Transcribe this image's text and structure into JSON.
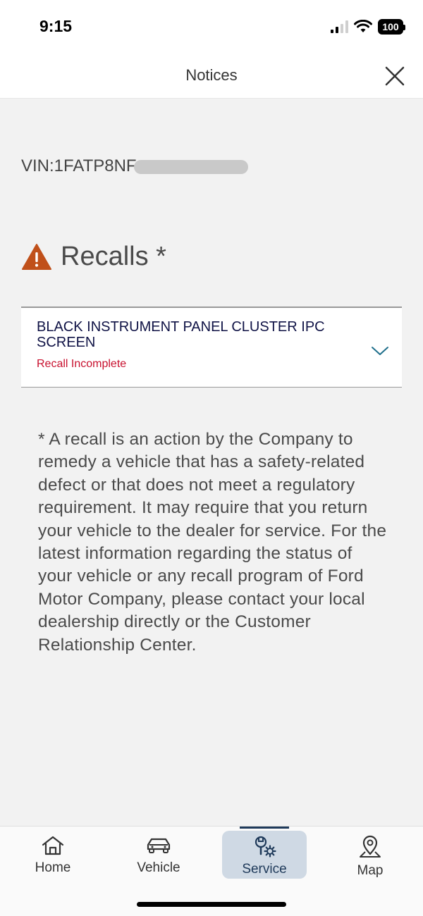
{
  "status": {
    "time": "9:15",
    "battery": "100"
  },
  "header": {
    "title": "Notices"
  },
  "vin": {
    "label": "VIN:1FATP8NF"
  },
  "recalls": {
    "title": "Recalls *"
  },
  "recall_items": [
    {
      "name": "BLACK INSTRUMENT PANEL CLUSTER IPC SCREEN",
      "status": "Recall Incomplete"
    }
  ],
  "footnote": "* A recall is an action by the Company to remedy a vehicle that has a safety-related defect or that does not meet a regulatory requirement. It may require that you return your vehicle to the dealer for service. For the latest information regarding the status of your vehicle or any recall program of Ford Motor Company, please contact your local dealership directly or the Customer Relationship Center.",
  "tabs": [
    {
      "label": "Home",
      "icon": "home-icon"
    },
    {
      "label": "Vehicle",
      "icon": "car-icon"
    },
    {
      "label": "Service",
      "icon": "service-wrench-gear-icon",
      "active": true
    },
    {
      "label": "Map",
      "icon": "map-pin-icon"
    }
  ],
  "colors": {
    "accent": "#1f3a5a",
    "warning": "#c0501a",
    "recall_status": "#c8102e",
    "recall_text": "#101346"
  }
}
